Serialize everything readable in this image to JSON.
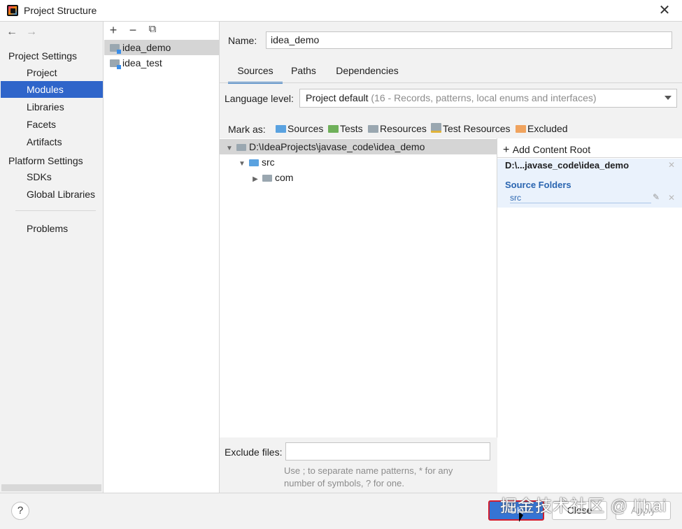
{
  "window": {
    "title": "Project Structure",
    "close_glyph": "✕"
  },
  "nav": {
    "back_glyph": "←",
    "forward_glyph": "→",
    "project_settings_header": "Project Settings",
    "project_settings_items": [
      "Project",
      "Modules",
      "Libraries",
      "Facets",
      "Artifacts"
    ],
    "platform_settings_header": "Platform Settings",
    "platform_settings_items": [
      "SDKs",
      "Global Libraries"
    ],
    "problems": "Problems",
    "selected": "Modules"
  },
  "modules": {
    "toolbar": {
      "add": "+",
      "remove": "−",
      "copy": "⧉"
    },
    "items": [
      "idea_demo",
      "idea_test"
    ],
    "selected": "idea_demo"
  },
  "module": {
    "name_label": "Name:",
    "name_value": "idea_demo",
    "tabs": [
      "Sources",
      "Paths",
      "Dependencies"
    ],
    "active_tab": "Sources",
    "language_level_label": "Language level:",
    "language_level_value": "Project default",
    "language_level_hint": "(16 - Records, patterns, local enums and interfaces)",
    "mark_as_label": "Mark as:",
    "mark_as": [
      {
        "label": "Sources",
        "color": "#5aa2e0"
      },
      {
        "label": "Tests",
        "color": "#6fb05a"
      },
      {
        "label": "Resources",
        "color": "#9aa7b0"
      },
      {
        "label": "Test Resources",
        "color": "#9aa7b0"
      },
      {
        "label": "Excluded",
        "color": "#f0a35e"
      }
    ],
    "tree": [
      {
        "label": "D:\\IdeaProjects\\javase_code\\idea_demo",
        "expanded": true,
        "selected": true
      },
      {
        "label": "src",
        "expanded": true
      },
      {
        "label": "com",
        "expanded": false
      }
    ],
    "add_content_root": "Add Content Root",
    "content_root_path": "D:\\...javase_code\\idea_demo",
    "source_folders_header": "Source Folders",
    "source_folder": "src",
    "exclude_files_label": "Exclude files:",
    "exclude_files_value": "",
    "exclude_hint_line1": "Use ; to separate name patterns, * for any",
    "exclude_hint_line2": "number of symbols, ? for one."
  },
  "footer": {
    "help": "?",
    "ok": "OK",
    "close": "Close",
    "apply": "Apply",
    "watermark": "掘金技术社区 @ ljhai"
  },
  "colors": {
    "selection": "#2f65ca",
    "accent": "#4083c9",
    "ok_button": "#3574d4",
    "highlight_border": "#d21d2f"
  }
}
